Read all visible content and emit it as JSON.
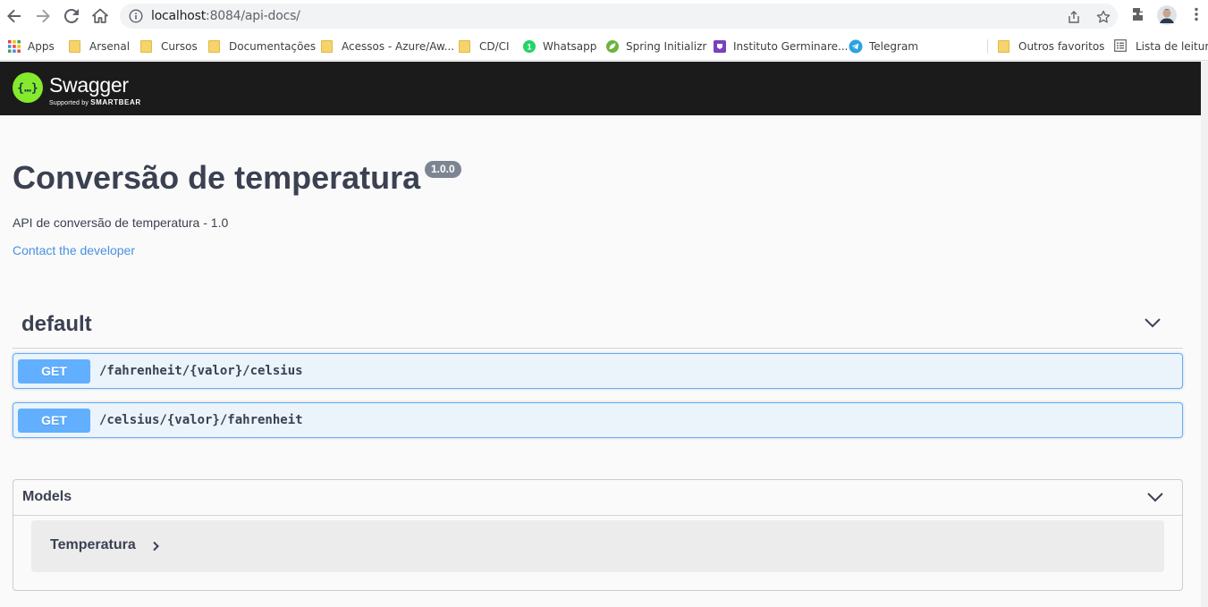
{
  "browser": {
    "url_host": "localhost",
    "url_path": ":8084/api-docs/",
    "bookmarks": [
      {
        "label": "Apps",
        "type": "apps"
      },
      {
        "label": "Arsenal",
        "type": "folder"
      },
      {
        "label": "Cursos",
        "type": "folder"
      },
      {
        "label": "Documentações",
        "type": "folder"
      },
      {
        "label": "Acessos - Azure/Aw...",
        "type": "folder"
      },
      {
        "label": "CD/CI",
        "type": "folder"
      },
      {
        "label": "Whatsapp",
        "type": "whatsapp"
      },
      {
        "label": "Spring Initializr",
        "type": "spring"
      },
      {
        "label": "Instituto Germinare...",
        "type": "germinare"
      },
      {
        "label": "Telegram",
        "type": "telegram"
      },
      {
        "label": "Outros favoritos",
        "type": "folder"
      },
      {
        "label": "Lista de leitura",
        "type": "reading-list"
      }
    ]
  },
  "swagger": {
    "logo_text": "Swagger",
    "logo_sub_prefix": "Supported by",
    "logo_sub_brand": "SMARTBEAR",
    "title": "Conversão de temperatura",
    "version": "1.0.0",
    "description": "API de conversão de temperatura - 1.0",
    "contact_label": "Contact the developer",
    "tag": "default",
    "operations": [
      {
        "method": "GET",
        "path": "/fahrenheit/{valor}/celsius"
      },
      {
        "method": "GET",
        "path": "/celsius/{valor}/fahrenheit"
      }
    ],
    "models_title": "Models",
    "models": [
      {
        "name": "Temperatura"
      }
    ]
  },
  "colors": {
    "get_method": "#61affe",
    "get_bg": "#ebf3fb",
    "topbar": "#1b1b1b",
    "logo": "#85ea2d",
    "link": "#4990e2",
    "text": "#3b4151"
  }
}
